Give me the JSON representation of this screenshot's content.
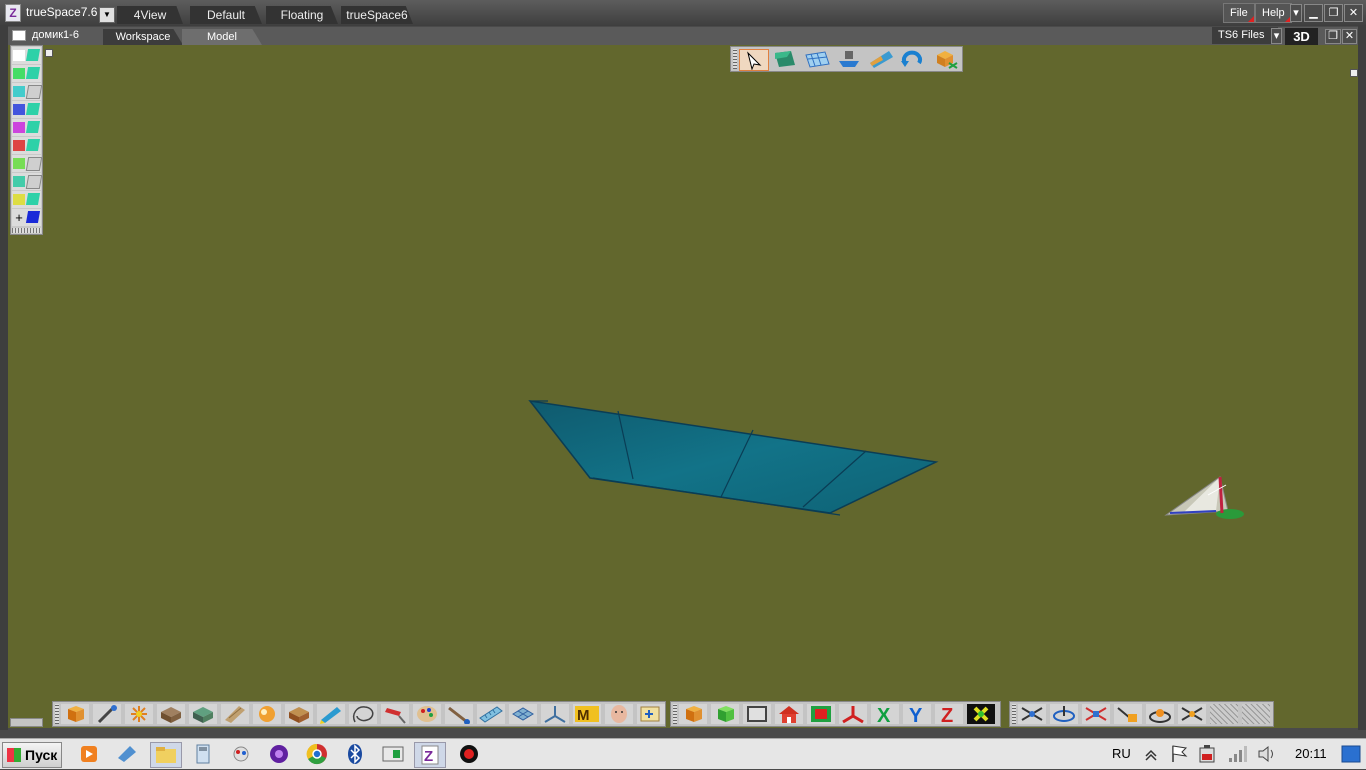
{
  "app": {
    "title": "trueSpace7.6"
  },
  "layouts": [
    "4View",
    "Default",
    "Floating",
    "trueSpace6"
  ],
  "menu": {
    "file": "File",
    "help": "Help"
  },
  "document": {
    "name": "домик1-6"
  },
  "workspace_tabs": [
    "Workspace",
    "Model"
  ],
  "right_bar": {
    "files_label": "TS6 Files",
    "mode_label": "3D"
  },
  "colors": {
    "viewport_bg": "#62672d",
    "plane_fill": "#0f6678",
    "accent_red": "#e02020"
  },
  "left_palette": {
    "swatches": [
      "#ffffff",
      "#44dd66",
      "#44cccc",
      "#4455dd",
      "#cc44dd",
      "#dd4444",
      "#77dd55",
      "#44ccaa",
      "#dddd44"
    ],
    "add_symbol": "+"
  },
  "top_toolbar": {
    "icons": [
      "object-tool-icon",
      "nav-cube-icon",
      "grid-plane-icon",
      "pedestal-icon",
      "render-icon",
      "undo-arc-icon",
      "box-pick-icon"
    ]
  },
  "bottom_toolbar_1": {
    "icons": [
      "cube-primitive-icon",
      "brush-icon",
      "light-burst-icon",
      "material-icon",
      "sweep-icon",
      "texture-icon",
      "shading-icon",
      "box-icon",
      "pencil-icon",
      "lasso-icon",
      "paint-icon",
      "palette-icon",
      "wand-icon",
      "ruler-icon",
      "mesh-icon",
      "axis-icon",
      "m-icon",
      "face-icon",
      "figure-icon"
    ]
  },
  "bottom_toolbar_2": {
    "icons": [
      "cube-orange-icon",
      "cube-green-icon",
      "frame-icon",
      "house-icon",
      "red-box-icon",
      "axes-icon",
      "x-axis-icon",
      "y-axis-icon",
      "z-axis-icon",
      "snap-icon"
    ],
    "axis_labels": [
      "X",
      "Y",
      "Z"
    ]
  },
  "bottom_toolbar_3": {
    "icons": [
      "move-icon",
      "rotate-icon",
      "scale-icon",
      "pan-icon",
      "orbit-icon",
      "zoom-icon",
      "grid1-icon",
      "grid2-icon"
    ]
  },
  "taskbar": {
    "start_label": "Пуск",
    "apps": [
      "media-player-icon",
      "eraser-icon",
      "folder-icon",
      "calculator-icon",
      "paint-icon",
      "player-icon",
      "chrome-icon",
      "bluetooth-icon",
      "window-icon",
      "truespace-icon",
      "record-icon"
    ],
    "language": "RU",
    "time": "20:11"
  }
}
